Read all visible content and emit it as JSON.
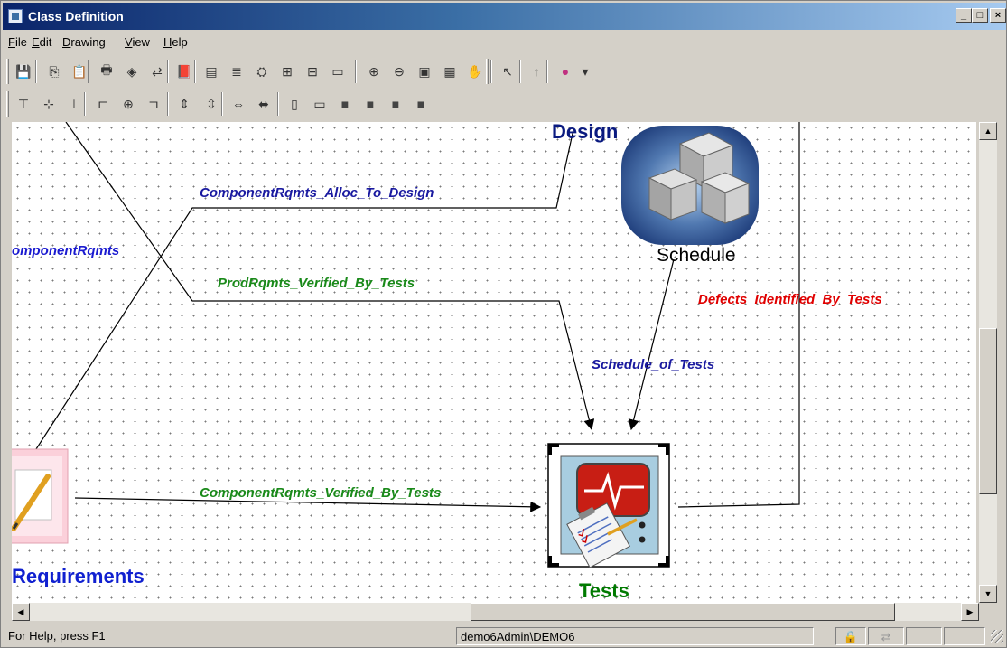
{
  "window": {
    "title": "Class Definition",
    "min": "_",
    "max": "□",
    "close": "×"
  },
  "menu": [
    {
      "label": "File",
      "u": "F",
      "rest": "ile"
    },
    {
      "label": "Edit",
      "u": "E",
      "rest": "dit"
    },
    {
      "label": "Drawing",
      "u": "D",
      "rest": "rawing"
    },
    {
      "label": "View",
      "u": "V",
      "rest": "iew"
    },
    {
      "label": "Help",
      "u": "H",
      "rest": "elp"
    }
  ],
  "toolbar1_icons": [
    "save-icon",
    "copy-icon",
    "paste-icon",
    "print-icon",
    "preview-icon",
    "connect-icon",
    "book-icon",
    "properties-icon",
    "attribute-icon",
    "find-icon",
    "expand-icon",
    "collapse-icon",
    "page-setup-icon",
    "zoom-in-icon",
    "zoom-out-icon",
    "fit-icon",
    "zoom-page-icon",
    "hand-icon",
    "pointer-icon",
    "arrow-up-icon",
    "palette-icon",
    "dropdown-icon"
  ],
  "toolbar2_icons": [
    "align-top-icon",
    "align-middle-icon",
    "align-bottom-icon",
    "align-left-icon",
    "align-center-icon",
    "align-right-icon",
    "space-vertical-icon",
    "space-vertical-even-icon",
    "space-horizontal-icon",
    "space-horizontal-even-icon",
    "same-width-icon",
    "same-height-icon",
    "layer-1-icon",
    "layer-2-icon",
    "layer-3-icon",
    "layer-4-icon"
  ],
  "diagram": {
    "nodes": {
      "design": {
        "label": "Design",
        "color": "#0a1a80"
      },
      "schedule": {
        "label": "Schedule",
        "color": "#000000"
      },
      "tests": {
        "label": "Tests",
        "color": "#007a00"
      },
      "requirements": {
        "label": "Requirements",
        "color": "#1020d0"
      }
    },
    "links": {
      "alloc": {
        "label": "ComponentRqmts_Alloc_To_Design",
        "color": "#1a1aa0"
      },
      "comp": {
        "label": "omponentRqmts",
        "color": "#1a1ad0"
      },
      "prod": {
        "label": "ProdRqmts_Verified_By_Tests",
        "color": "#1a8a1a"
      },
      "defects": {
        "label": "Defects_Identified_By_Tests",
        "color": "#e00000"
      },
      "sched": {
        "label": "Schedule_of_Tests",
        "color": "#1a1aa0"
      },
      "compver": {
        "label": "ComponentRqmts_Verified_By_Tests",
        "color": "#1a8a1a"
      }
    }
  },
  "status": {
    "help": "For Help, press F1",
    "user": "demo6Admin\\DEMO6"
  }
}
